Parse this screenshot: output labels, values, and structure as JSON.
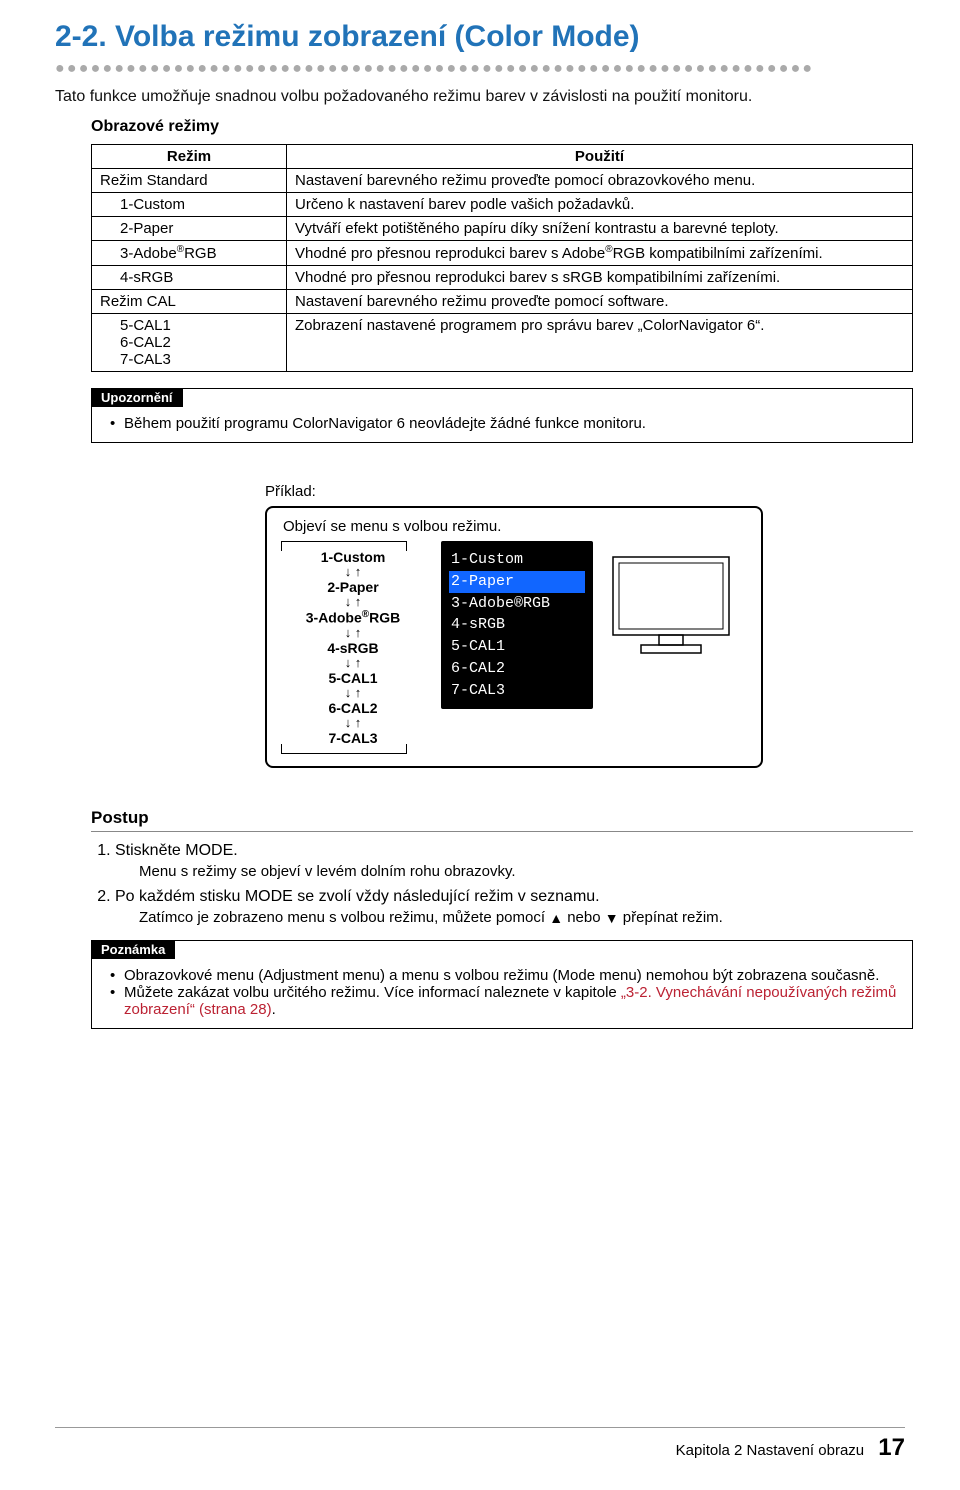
{
  "section": {
    "number": "2-2.",
    "title": "Volba režimu zobrazení (Color Mode)",
    "intro": "Tato funkce umožňuje snadnou volbu požadovaného režimu barev v závislosti na použití monitoru.",
    "subhead": "Obrazové režimy"
  },
  "table": {
    "head_mode": "Režim",
    "head_use": "Použití",
    "rows": [
      {
        "mode": "Režim Standard",
        "desc": "Nastavení barevného režimu proveďte pomocí obrazovkového menu.",
        "indent": false
      },
      {
        "mode": "1-Custom",
        "desc": "Určeno k nastavení barev podle vašich požadavků.",
        "indent": true
      },
      {
        "mode": "2-Paper",
        "desc": "Vytváří efekt potištěného papíru díky snížení kontrastu a barevné teploty.",
        "indent": true
      },
      {
        "mode": "3-Adobe®RGB",
        "desc": "Vhodné pro přesnou reprodukci barev s Adobe®RGB kompatibilními zařízeními.",
        "indent": true
      },
      {
        "mode": "4-sRGB",
        "desc": "Vhodné pro přesnou reprodukci barev s sRGB kompatibilními zařízeními.",
        "indent": true
      },
      {
        "mode": "Režim CAL",
        "desc": "Nastavení barevného režimu proveďte pomocí software.",
        "indent": false
      },
      {
        "mode": "5-CAL1\n6-CAL2\n7-CAL3",
        "desc": "Zobrazení nastavené programem pro správu barev „ColorNavigator 6“.",
        "indent": true
      }
    ]
  },
  "warn": {
    "label": "Upozornění",
    "items": [
      "Během použití programu ColorNavigator 6 neovládejte žádné funkce monitoru."
    ]
  },
  "example": {
    "label": "Příklad:",
    "caption": "Objeví se menu s volbou režimu.",
    "flow": [
      "1-Custom",
      "2-Paper",
      "3-Adobe®RGB",
      "4-sRGB",
      "5-CAL1",
      "6-CAL2",
      "7-CAL3"
    ],
    "osd": [
      "1-Custom",
      "2-Paper",
      "3-Adobe®RGB",
      "4-sRGB",
      "5-CAL1",
      "6-CAL2",
      "7-CAL3"
    ],
    "osd_selected_index": 1
  },
  "postup": {
    "head": "Postup",
    "step1": "Stiskněte MODE.",
    "step1_sub": "Menu s režimy se objeví v levém dolním rohu obrazovky.",
    "step2_a": "Po každém stisku MODE se zvolí vždy následující režim v seznamu.",
    "step2_sub_a": "Zatímco je zobrazeno menu s volbou režimu, můžete pomocí ",
    "step2_sub_b": " nebo ",
    "step2_sub_c": " přepínat režim."
  },
  "note": {
    "label": "Poznámka",
    "items": [
      "Obrazovkové menu (Adjustment menu) a menu s volbou režimu (Mode menu) nemohou být zobrazena současně.",
      "Můžete zakázat volbu určitého režimu. Více informací naleznete v kapitole „3-2. Vynechávání nepoužívaných režimů zobrazení“ (strana 28)."
    ],
    "link_text": "„3-2. Vynechávání nepoužívaných režimů zobrazení“ (strana 28)"
  },
  "footer": {
    "chapter": "Kapitola 2 Nastavení obrazu",
    "page": "17"
  }
}
